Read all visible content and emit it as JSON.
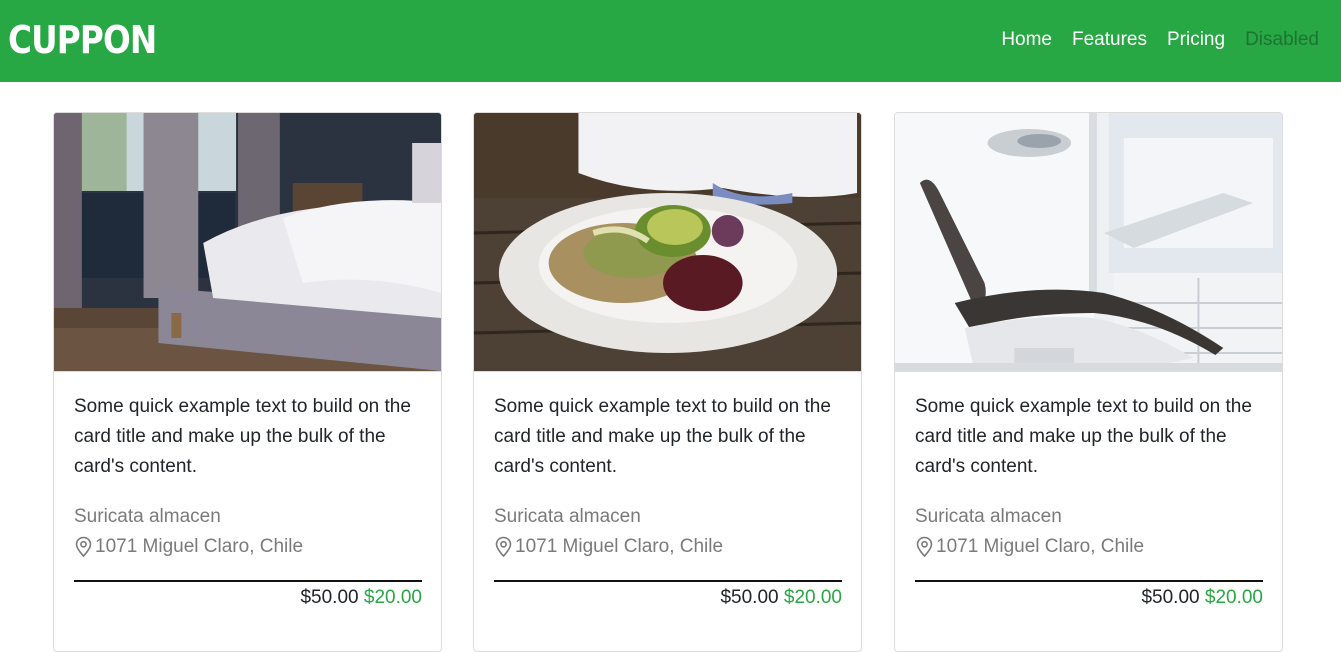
{
  "brand": "CUPPON",
  "nav": {
    "home": "Home",
    "features": "Features",
    "pricing": "Pricing",
    "disabled": "Disabled"
  },
  "colors": {
    "primary": "#28a745",
    "muted": "#7a7a7a",
    "text": "#212529"
  },
  "cards": [
    {
      "image": "bedroom-photo",
      "text": "Some quick example text to build on the card title and make up the bulk of the card's content.",
      "store": "Suricata almacen",
      "address": "1071 Miguel Claro, Chile",
      "old_price": "$50.00",
      "new_price": "$20.00"
    },
    {
      "image": "salad-plate-photo",
      "text": "Some quick example text to build on the card title and make up the bulk of the card's content.",
      "store": "Suricata almacen",
      "address": "1071 Miguel Claro, Chile",
      "old_price": "$50.00",
      "new_price": "$20.00"
    },
    {
      "image": "dental-chair-photo",
      "text": "Some quick example text to build on the card title and make up the bulk of the card's content.",
      "store": "Suricata almacen",
      "address": "1071 Miguel Claro, Chile",
      "old_price": "$50.00",
      "new_price": "$20.00"
    }
  ]
}
